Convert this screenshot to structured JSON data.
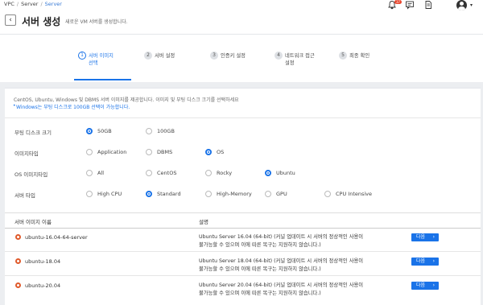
{
  "breadcrumb": [
    "VPC",
    "Server",
    "Server"
  ],
  "header": {
    "title": "서버 생성",
    "subtitle": "새로운 VM 서버를 생성합니다.",
    "notification_count": "37"
  },
  "steps": [
    {
      "num": "1",
      "label": "서버 이미지\n선택",
      "active": true
    },
    {
      "num": "2",
      "label": "서버 설정",
      "active": false
    },
    {
      "num": "3",
      "label": "인증키 설정",
      "active": false
    },
    {
      "num": "4",
      "label": "네트워크 접근\n설정",
      "active": false
    },
    {
      "num": "5",
      "label": "최종 확인",
      "active": false
    }
  ],
  "info": {
    "line1": "CentOS, Ubuntu, Windows 및 DBMS 서버 이미지를 제공합니다. 이미지 및 부팅 디스크 크기를 선택하세요",
    "line2": "Windows는 부팅 디스크로 100GB 선택이 가능합니다."
  },
  "filters": {
    "boot_disk": {
      "label": "부팅 디스크 크기",
      "options": [
        "50GB",
        "100GB"
      ],
      "selected": "50GB"
    },
    "image_type": {
      "label": "이미지타입",
      "options": [
        "Application",
        "DBMS",
        "OS"
      ],
      "selected": "OS"
    },
    "os_image_type": {
      "label": "OS 이미지타입",
      "options": [
        "All",
        "CentOS",
        "Rocky",
        "Ubuntu"
      ],
      "selected": "Ubuntu"
    },
    "server_type": {
      "label": "서버 타입",
      "options": [
        "High CPU",
        "Standard",
        "High-Memory",
        "GPU",
        "CPU Intensive"
      ],
      "selected": "Standard"
    }
  },
  "table": {
    "columns": [
      "서버 이미지 이름",
      "설명"
    ],
    "rows": [
      {
        "name": "ubuntu-16.04-64-server",
        "desc1": "Ubuntu Server 16.04 (64-bit) (커널 업데이트 시 서버의 정상적인 사용이",
        "desc2": "불가능할 수 있으며 이에 따른 복구는 지원하지 않습니다.)",
        "button": "다음"
      },
      {
        "name": "ubuntu-18.04",
        "desc1": "Ubuntu Server 18.04 (64-bit) (커널 업데이트 시 서버의 정상적인 사용이",
        "desc2": "불가능할 수 있으며 이에 따른 복구는 지원하지 않습니다.)",
        "button": "다음"
      },
      {
        "name": "ubuntu-20.04",
        "desc1": "Ubuntu Server 20.04 (64-bit) (커널 업데이트 시 서버의 정상적인 사용이",
        "desc2": "불가능할 수 있으며 이에 따른 복구는 지원하지 않습니다.)",
        "button": "다음"
      }
    ]
  },
  "colors": {
    "accent": "#1a73e8",
    "badge": "#e8452c",
    "os_icon": "#e05a2b"
  },
  "icons": [
    "bell-icon",
    "chat-icon",
    "document-icon",
    "user-avatar-icon",
    "back-arrow-icon",
    "chevron-right-icon"
  ]
}
